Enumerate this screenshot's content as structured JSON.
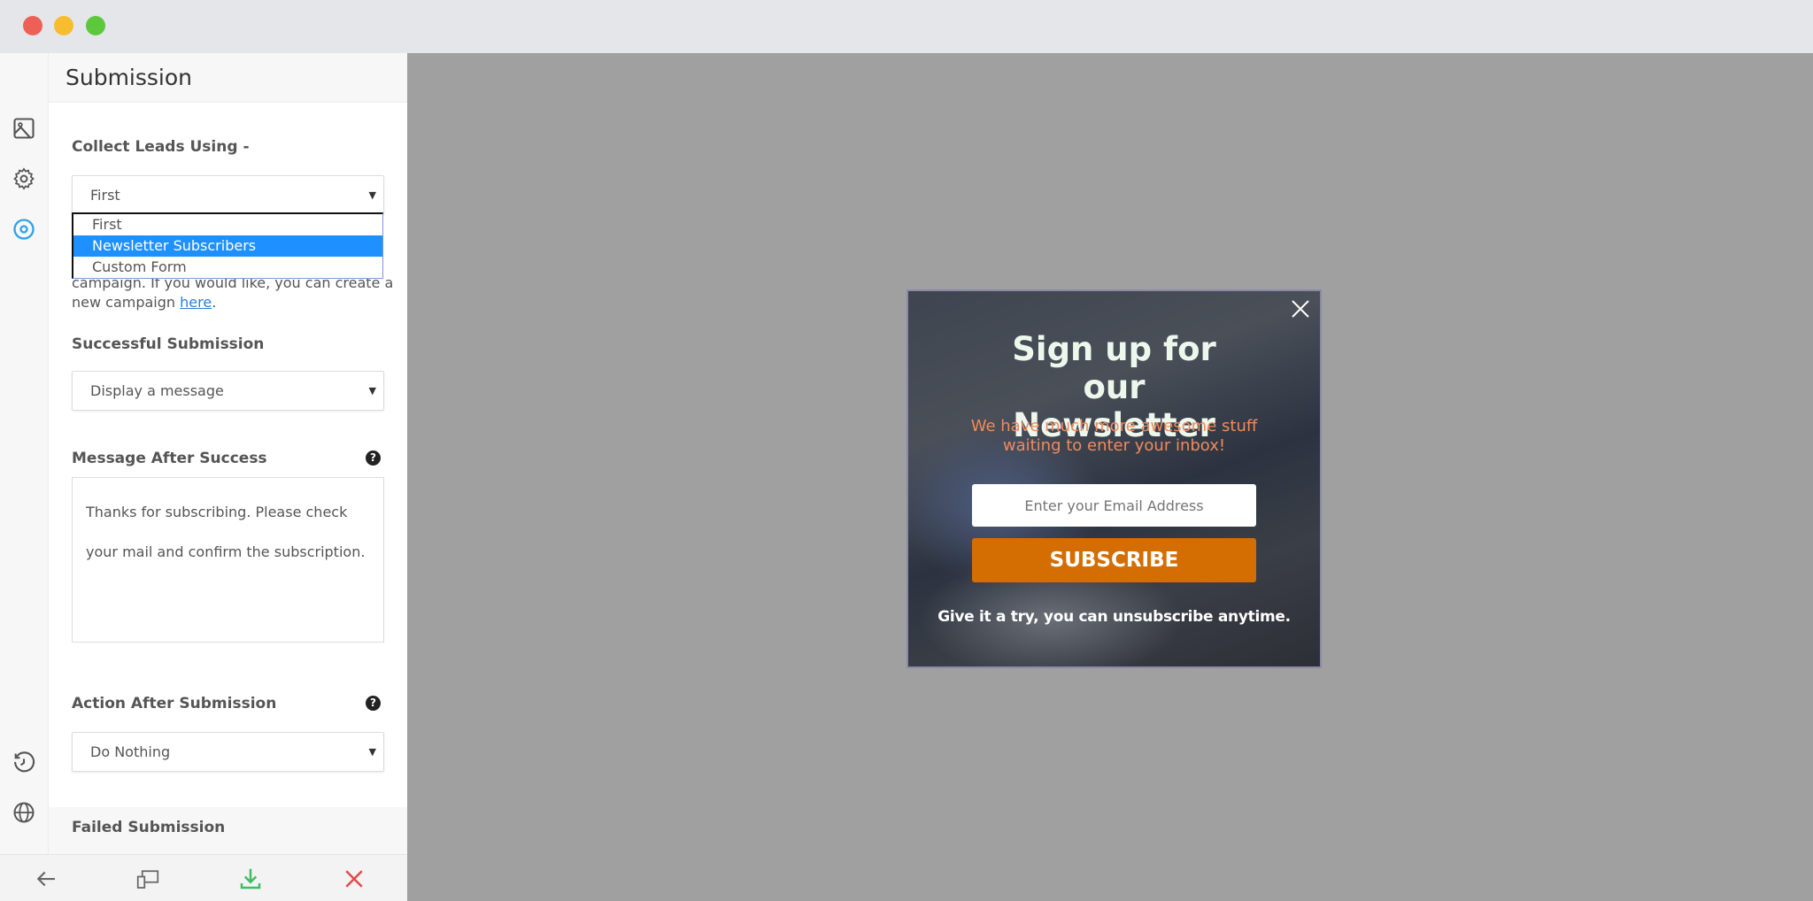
{
  "window": {
    "controls": [
      {
        "name": "close",
        "color": "#ee5f57"
      },
      {
        "name": "minimize",
        "color": "#f8bc2f"
      },
      {
        "name": "maximize",
        "color": "#5dc83c"
      }
    ]
  },
  "rail": {
    "top_icons": [
      "image-icon",
      "gear-icon",
      "target-icon"
    ],
    "bottom_icons": [
      "history-icon",
      "globe-icon"
    ],
    "active_color": "#2ea3e6"
  },
  "panel": {
    "title": "Submission",
    "collect_label": "Collect Leads Using -",
    "collect_value": "First",
    "collect_options": [
      "First",
      "Newsletter Subscribers",
      "Custom Form"
    ],
    "collect_highlighted": "Newsletter Subscribers",
    "campaign_text_1": "campaign. If you would like, you can create a",
    "campaign_text_2": "new campaign ",
    "campaign_link": "here",
    "campaign_end": ".",
    "success_label": "Successful Submission",
    "success_value": "Display a message",
    "message_label": "Message After Success",
    "message_value": "Thanks for subscribing. Please check your mail and confirm the subscription.",
    "action_label": "Action After Submission",
    "action_value": "Do Nothing",
    "failed_label": "Failed Submission",
    "help_glyph": "?"
  },
  "bottom_bar": {
    "icons": [
      "arrow-left-icon",
      "responsive-devices-icon",
      "download-icon",
      "close-icon"
    ],
    "colors": {
      "download": "#3cbf63",
      "close": "#e24a4a"
    }
  },
  "popup": {
    "title": "Sign up for our Newsletter",
    "subtitle": "We have much more awesome stuff waiting to enter your inbox!",
    "email_placeholder": "Enter your Email Address",
    "button": "SUBSCRIBE",
    "footer": "Give it a try, you can unsubscribe anytime.",
    "button_color": "#d46e02",
    "subtitle_color": "#f08a5d"
  }
}
